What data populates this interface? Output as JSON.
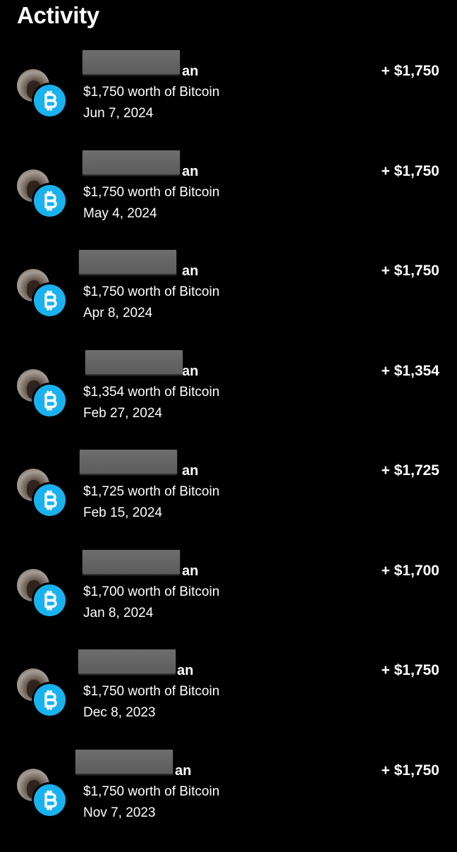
{
  "header": {
    "title": "Activity"
  },
  "coin_color": "#1ab2ee",
  "transactions": [
    {
      "name_visible": "an",
      "amount": "+ $1,750",
      "description": "$1,750 worth of Bitcoin",
      "date": "Jun 7, 2024"
    },
    {
      "name_visible": "an",
      "amount": "+ $1,750",
      "description": "$1,750 worth of Bitcoin",
      "date": "May 4, 2024"
    },
    {
      "name_visible": "an",
      "amount": "+ $1,750",
      "description": "$1,750 worth of Bitcoin",
      "date": "Apr 8, 2024"
    },
    {
      "name_visible": "an",
      "amount": "+ $1,354",
      "description": "$1,354 worth of Bitcoin",
      "date": "Feb 27, 2024"
    },
    {
      "name_visible": "an",
      "amount": "+ $1,725",
      "description": "$1,725 worth of Bitcoin",
      "date": "Feb 15, 2024"
    },
    {
      "name_visible": "an",
      "amount": "+ $1,700",
      "description": "$1,700 worth of Bitcoin",
      "date": "Jan 8, 2024"
    },
    {
      "name_visible": "an",
      "amount": "+ $1,750",
      "description": "$1,750 worth of Bitcoin",
      "date": "Dec 8, 2023"
    },
    {
      "name_visible": "an",
      "amount": "+ $1,750",
      "description": "$1,750 worth of Bitcoin",
      "date": "Nov 7, 2023"
    }
  ]
}
